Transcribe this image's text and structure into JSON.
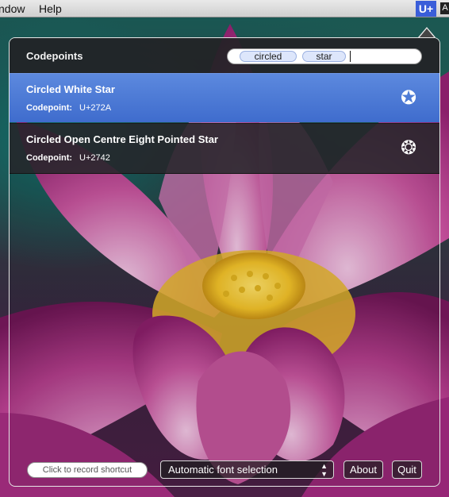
{
  "menubar": {
    "window_label": "ndow",
    "help_label": "Help",
    "status_item_label": "U+",
    "status_extra_label": "A"
  },
  "panel": {
    "title": "Codepoints",
    "search": {
      "tokens": [
        "circled",
        "star"
      ]
    },
    "results": [
      {
        "name": "Circled White Star",
        "codepoint_label": "Codepoint:",
        "codepoint_value": "U+272A",
        "glyph": "✪",
        "selected": true
      },
      {
        "name": "Circled Open Centre Eight Pointed Star",
        "codepoint_label": "Codepoint:",
        "codepoint_value": "U+2742",
        "glyph": "❂",
        "selected": false
      }
    ],
    "footer": {
      "shortcut_placeholder": "Click to record shortcut",
      "font_select_value": "Automatic font selection",
      "about_label": "About",
      "quit_label": "Quit"
    }
  },
  "colors": {
    "selection": "#4a78d6",
    "status_item": "#3a5ed9"
  },
  "icons": {
    "select_arrows": "up-down-arrows-icon"
  }
}
